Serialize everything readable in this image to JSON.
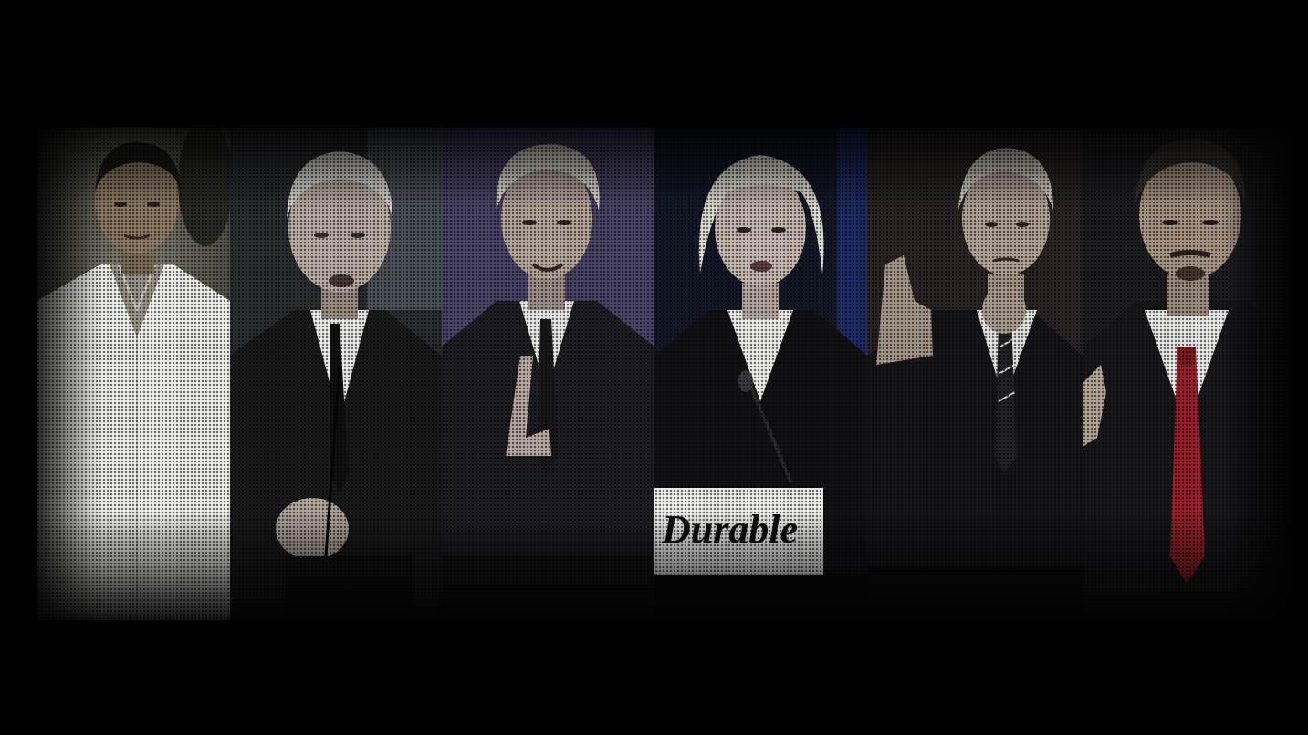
{
  "image": {
    "subject": "",
    "sign_text": "Durable"
  },
  "colors": {
    "background": "#000000",
    "tie_red": "#9c1f2a",
    "tie_dark": "#1a1a1a",
    "panel_purple": "#4a4468"
  }
}
